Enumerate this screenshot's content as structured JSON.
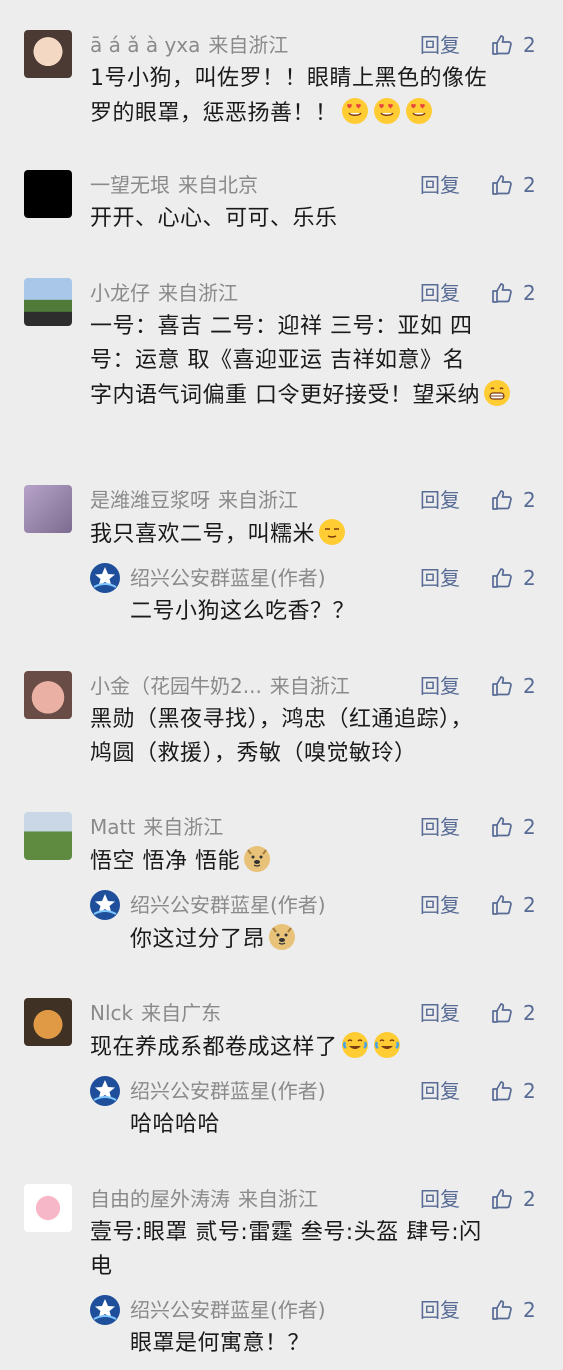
{
  "ui": {
    "reply_label": "回复",
    "accent": "#576b95",
    "author_tag": "(作者)"
  },
  "comments": [
    {
      "name": "ā á ǎ à yxa",
      "location": "来自浙江",
      "likes": "2",
      "lines": [
        "1号小狗，叫佐罗！！眼睛上黑色的像佐",
        "罗的眼罩，惩恶扬善！！"
      ],
      "emoji": [
        "heart-eyes-icon",
        "heart-eyes-icon",
        "heart-eyes-icon"
      ]
    },
    {
      "name": "一望无垠",
      "location": "来自北京",
      "likes": "2",
      "lines": [
        "开开、心心、可可、乐乐"
      ]
    },
    {
      "name": "小龙仔",
      "location": "来自浙江",
      "likes": "2",
      "lines": [
        "一号：喜吉  二号：迎祥  三号：亚如  四",
        "号：运意  取《喜迎亚运 吉祥如意》名",
        "字内语气词偏重 口令更好接受！望采纳"
      ],
      "emoji": [
        "grin-icon"
      ]
    },
    {
      "name": "是潍潍豆浆呀",
      "location": "来自浙江",
      "likes": "2",
      "lines": [
        "我只喜欢二号，叫糯米"
      ],
      "emoji": [
        "smug-icon"
      ],
      "reply": {
        "name": "绍兴公安群蓝星(作者)",
        "likes": "2",
        "text": "二号小狗这么吃香？？"
      }
    },
    {
      "name": "小金（花园牛奶2...",
      "location": "来自浙江",
      "likes": "2",
      "lines": [
        "黑勋（黑夜寻找），鸿忠（红通追踪），",
        "鸠圆（救援），秀敏（嗅觉敏玲）"
      ]
    },
    {
      "name": "Matt",
      "location": "来自浙江",
      "likes": "2",
      "lines": [
        "悟空 悟净 悟能"
      ],
      "emoji": [
        "doge-icon"
      ],
      "reply": {
        "name": "绍兴公安群蓝星(作者)",
        "likes": "2",
        "text": "你这过分了昂",
        "emoji": [
          "doge-icon"
        ]
      }
    },
    {
      "name": "Nlck",
      "location": "来自广东",
      "likes": "2",
      "lines": [
        "现在养成系都卷成这样了"
      ],
      "emoji": [
        "laugh-cry-icon",
        "laugh-cry-icon"
      ],
      "reply": {
        "name": "绍兴公安群蓝星(作者)",
        "likes": "2",
        "text": "哈哈哈哈"
      }
    },
    {
      "name": "自由的屋外涛涛",
      "location": "来自浙江",
      "likes": "2",
      "lines": [
        "壹号:眼罩 贰号:雷霆 叁号:头盔 肆号:闪",
        "电"
      ],
      "reply": {
        "name": "绍兴公安群蓝星(作者)",
        "likes": "2",
        "text": "眼罩是何寓意！？"
      }
    }
  ]
}
